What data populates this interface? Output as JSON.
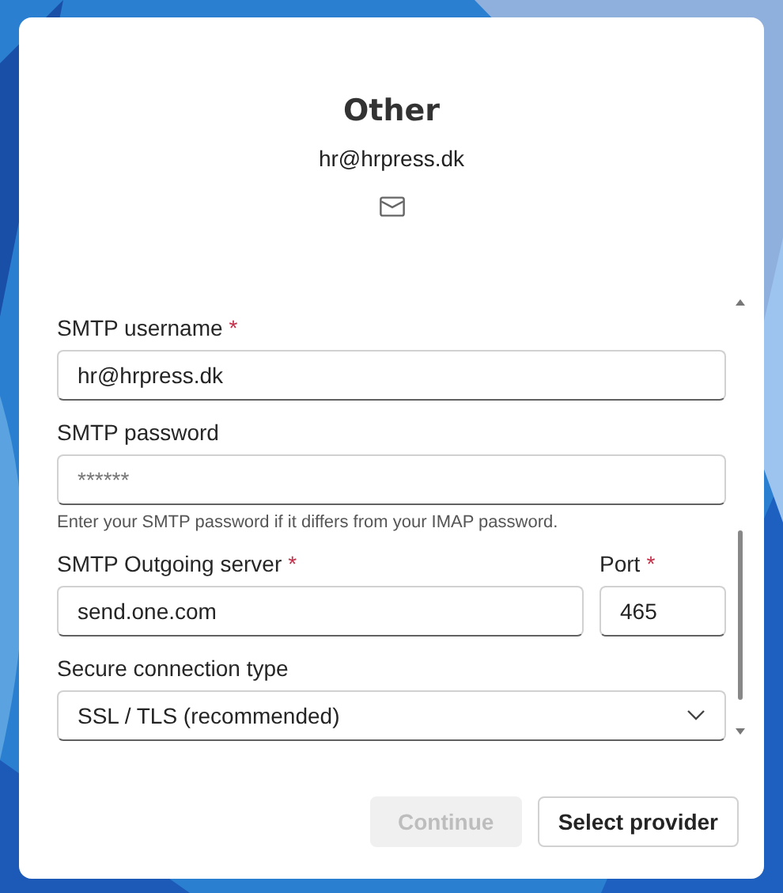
{
  "dialog": {
    "title": "Other",
    "email": "hr@hrpress.dk"
  },
  "rows": [
    {
      "fields": [
        {
          "kind": "text",
          "label": "SMTP username",
          "required_mark": "*",
          "value": "hr@hrpress.dk"
        }
      ]
    },
    {
      "fields": [
        {
          "kind": "text",
          "label": "SMTP password",
          "placeholder": "******",
          "hint": "Enter your SMTP password if it differs from your IMAP password."
        }
      ]
    },
    {
      "fields": [
        {
          "kind": "text",
          "label": "SMTP Outgoing server",
          "required_mark": "*",
          "value": "send.one.com"
        },
        {
          "kind": "short",
          "label": "Port",
          "required_mark": "*",
          "value": "465"
        }
      ]
    },
    {
      "fields": [
        {
          "kind": "select",
          "label": "Secure connection type",
          "value": "SSL / TLS (recommended)"
        }
      ]
    }
  ],
  "buttons": [
    {
      "label": "Continue",
      "disabled": true
    },
    {
      "label": "Select provider",
      "disabled": false
    }
  ]
}
